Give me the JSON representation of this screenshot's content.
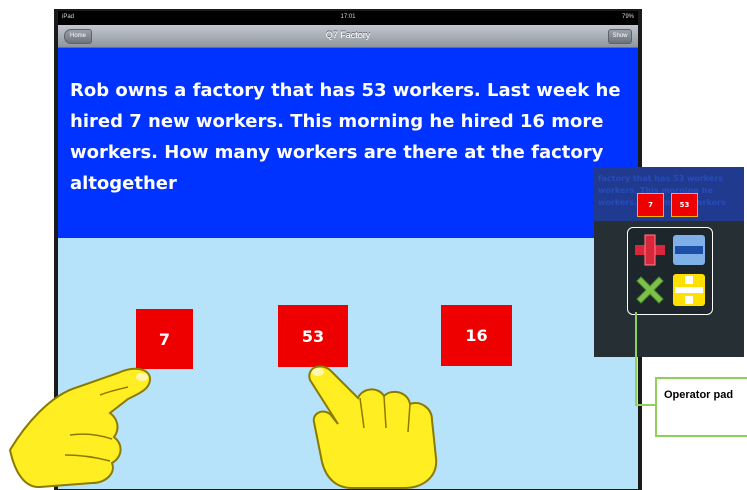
{
  "statusbar": {
    "device": "iPad",
    "time": "17:01",
    "battery": "79%"
  },
  "navbar": {
    "title": "Q7 Factory",
    "back_label": "Home",
    "right_label": "Show"
  },
  "question": {
    "text": "Rob owns a factory that has 53 workers. Last week he hired 7 new workers. This morning he hired 16 more workers. How many workers are there at the factory altogether"
  },
  "tiles": [
    "7",
    "53",
    "16"
  ],
  "inset": {
    "text_lines": [
      "factory that has 53 workers",
      "workers. This morning he",
      "workers. How many workers"
    ],
    "tiles": [
      "7",
      "53"
    ],
    "operators": [
      "add-icon",
      "subtract-icon",
      "multiply-icon",
      "divide-icon"
    ]
  },
  "callout": {
    "label": "Operator pad"
  },
  "colors": {
    "question_bg": "#0033ff",
    "work_bg": "#b6e2fa",
    "tile": "#ee0000",
    "callout_border": "#8fcf5a"
  }
}
